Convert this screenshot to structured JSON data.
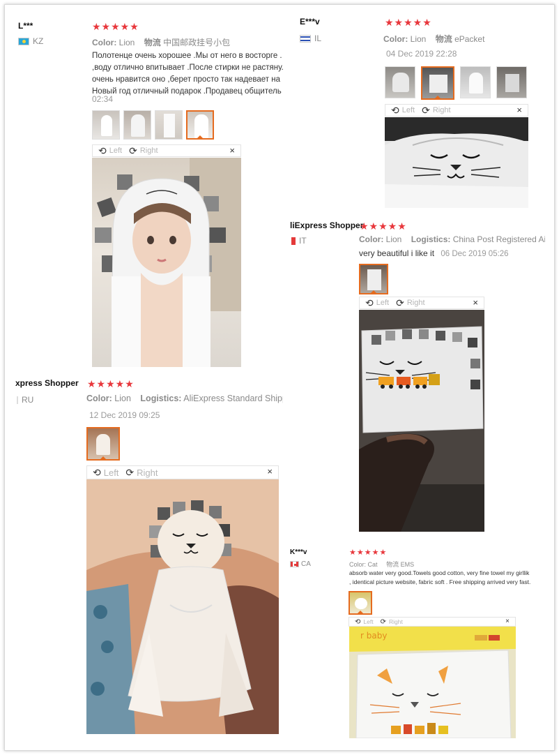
{
  "rotate_left_label": "Left",
  "rotate_right_label": "Right",
  "close_glyph": "×",
  "rotate_left_glyph": "⟲",
  "rotate_right_glyph": "⟳",
  "reviews": [
    {
      "name": "L***",
      "country": "KZ",
      "stars": "★★★★★",
      "color_label": "Color:",
      "color_value": "Lion",
      "logistics_label": "物流",
      "logistics_value": "中国邮政挂号小包",
      "text_lines": [
        "Полотенце очень хорошее .Мы от него в восторге .",
        ",воду отлично впитывает .После стирки не растяну.",
        "очень нравится оно ,берет просто так надевает на",
        "Новый год отличный подарок .Продавец общитель"
      ],
      "date": "02:34"
    },
    {
      "name": "E***v",
      "country": "IL",
      "stars": "★★★★★",
      "color_label": "Color:",
      "color_value": "Lion",
      "logistics_label": "物流",
      "logistics_value": "ePacket",
      "date": "04 Dec 2019 22:28"
    },
    {
      "name": "liExpress Shopper",
      "country": "IT",
      "stars": "★★★★★",
      "color_label": "Color:",
      "color_value": "Lion",
      "logistics_label": "Logistics:",
      "logistics_value": "China Post Registered Air Ma",
      "text": "very beautiful i like it",
      "date": "06 Dec 2019 05:26"
    },
    {
      "name": "xpress Shopper",
      "country": "RU",
      "stars": "★★★★★",
      "color_label": "Color:",
      "color_value": "Lion",
      "logistics_label": "Logistics:",
      "logistics_value": "AliExpress Standard Shipp",
      "date": "12 Dec 2019 09:25"
    },
    {
      "name": "K***v",
      "country": "CA",
      "stars": "★★★★★",
      "color_label": "Color:",
      "color_value": "Cat",
      "logistics_label": "物流",
      "logistics_value": "EMS",
      "text_lines": [
        "absorb water very good.Towels good cotton,  very fine towel my girllik",
        ", identical picture website, fabric soft . Free shipping arrived very fast."
      ],
      "package_text": "r baby"
    }
  ],
  "colors": {
    "star": "#e8373c",
    "active_thumb": "#e56b1f",
    "meta_text": "#8a8a8a"
  }
}
